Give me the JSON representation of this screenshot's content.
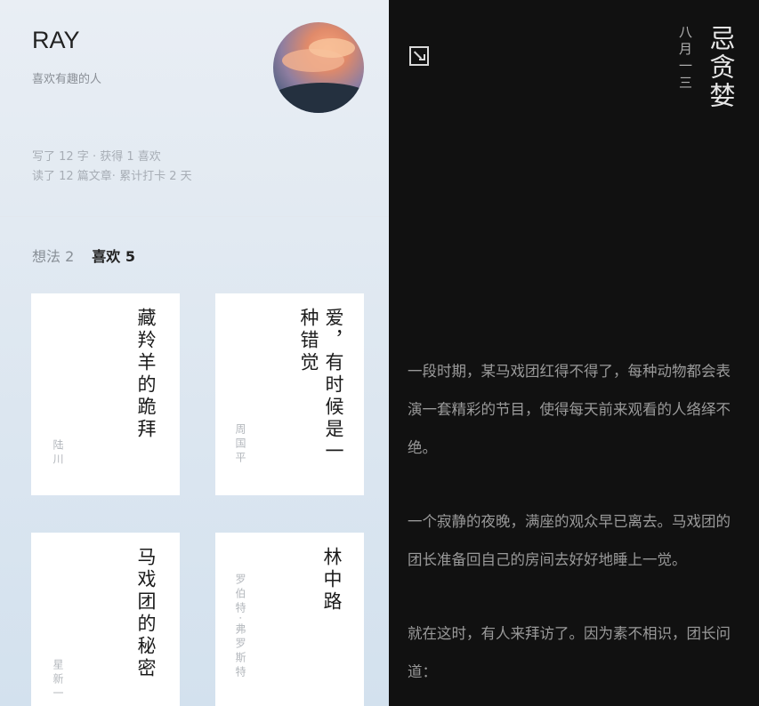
{
  "profile": {
    "name": "RAY",
    "bio": "喜欢有趣的人",
    "stats_line1": "写了 12 字 · 获得 1 喜欢",
    "stats_line2": "读了 12 篇文章· 累计打卡 2 天"
  },
  "tabs": [
    {
      "label": "想法 2",
      "active": false
    },
    {
      "label": "喜欢 5",
      "active": true
    }
  ],
  "cards": [
    {
      "title": "藏羚羊的跪拜",
      "author": "陆川"
    },
    {
      "title": "爱，有时候是一种错觉",
      "author": "周国平"
    },
    {
      "title": "马戏团的秘密",
      "author": "星新一"
    },
    {
      "title": "林中路",
      "author": "罗伯特·弗罗斯特"
    }
  ],
  "article": {
    "title": "忌贪婪",
    "date": "八月一三",
    "paragraphs": [
      "一段时期，某马戏团红得不得了，每种动物都会表演一套精彩的节目，使得每天前来观看的人络绎不绝。",
      "一个寂静的夜晚，满座的观众早已离去。马戏团的团长准备回自己的房间去好好地睡上一觉。",
      "就在这时，有人来拜访了。因为素不相识，团长问道："
    ]
  },
  "icons": {
    "back": "exit-square-icon"
  },
  "colors": {
    "left_bg": "#e3ebf3",
    "right_bg": "#111111",
    "card_bg": "#ffffff"
  }
}
